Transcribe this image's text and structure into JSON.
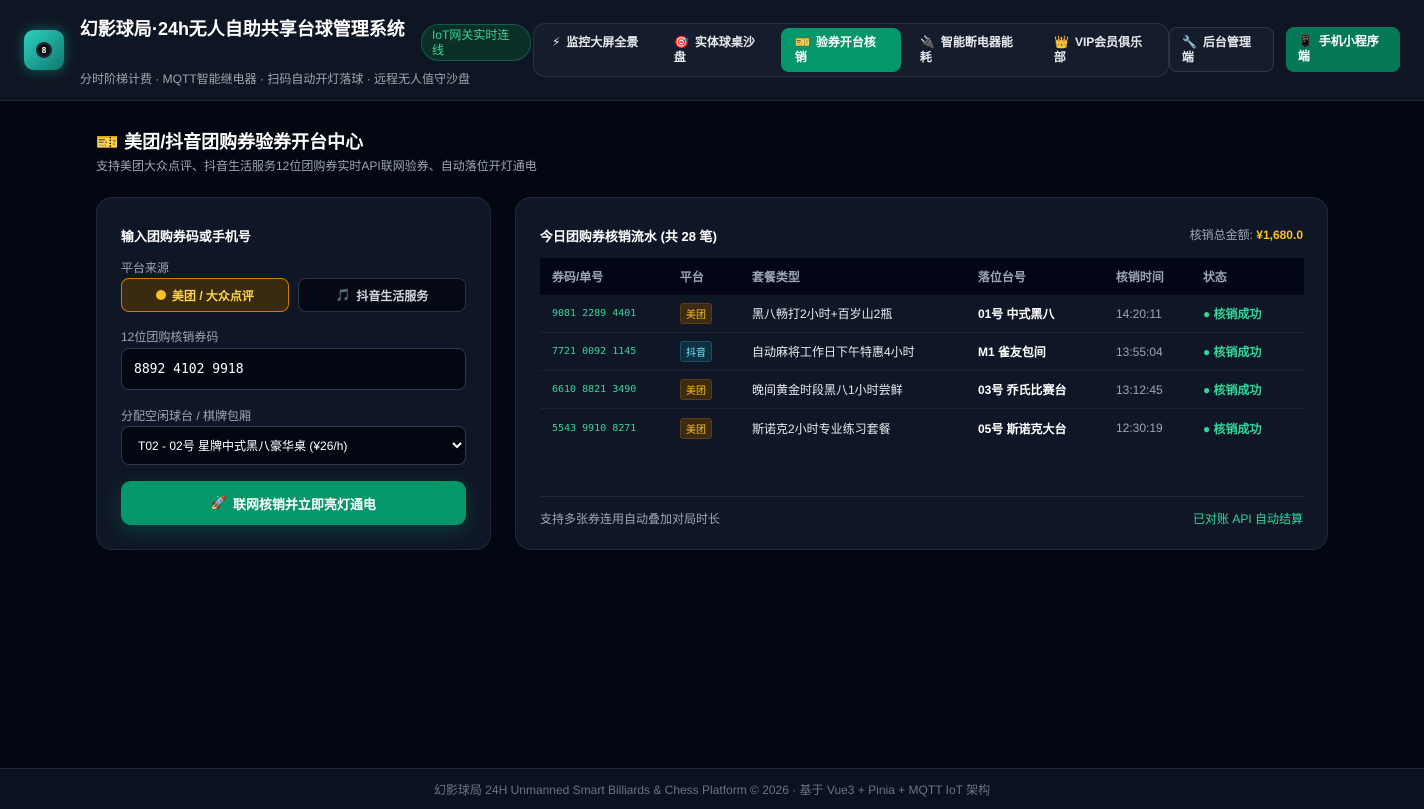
{
  "header": {
    "title": "幻影球局·24h无人自助共享台球管理系统",
    "subtitle": "分时阶梯计费 · MQTT智能继电器 · 扫码自动开灯落球 · 远程无人值守沙盘",
    "iot_badge": "IoT网关实时连线",
    "nav": [
      {
        "icon": "⚡",
        "label": "监控大屏全景"
      },
      {
        "icon": "🎯",
        "label": "实体球桌沙盘"
      },
      {
        "icon": "🎫",
        "label": "验券开台核销"
      },
      {
        "icon": "🔌",
        "label": "智能断电器能耗"
      },
      {
        "icon": "👑",
        "label": "VIP会员俱乐部"
      }
    ],
    "admin_icon": "🔧",
    "admin_label": "后台管理端",
    "mini_icon": "📱",
    "mini_label": "手机小程序端"
  },
  "page": {
    "icon": "🎫",
    "title": "美团/抖音团购券验券开台中心",
    "desc": "支持美团大众点评、抖音生活服务12位团购券实时API联网验券、自动落位开灯通电"
  },
  "form": {
    "heading": "输入团购券码或手机号",
    "platform_label": "平台来源",
    "platform_meituan": "美团 / 大众点评",
    "platform_douyin_icon": "🎵",
    "platform_douyin": "抖音生活服务",
    "code_label": "12位团购核销券码",
    "code_value": "8892 4102 9918",
    "table_label": "分配空闲球台 / 棋牌包厢",
    "table_value": "T02 - 02号 星牌中式黑八豪华桌 (¥26/h)",
    "submit_icon": "🚀",
    "submit_label": "联网核销并立即亮灯通电"
  },
  "records": {
    "heading": "今日团购券核销流水 (共 28 笔)",
    "total_label": "核销总金额:",
    "total_value": "¥1,680.0",
    "columns": [
      "券码/单号",
      "平台",
      "套餐类型",
      "落位台号",
      "核销时间",
      "状态"
    ],
    "rows": [
      {
        "code": "9081 2289 4401",
        "platform": "美团",
        "package": "黑八畅打2小时+百岁山2瓶",
        "table": "01号 中式黑八",
        "time": "14:20:11",
        "status": "● 核销成功"
      },
      {
        "code": "7721 0092 1145",
        "platform": "抖音",
        "package": "自动麻将工作日下午特惠4小时",
        "table": "M1 雀友包间",
        "time": "13:55:04",
        "status": "● 核销成功"
      },
      {
        "code": "6610 8821 3490",
        "platform": "美团",
        "package": "晚间黄金时段黑八1小时尝鲜",
        "table": "03号 乔氏比赛台",
        "time": "13:12:45",
        "status": "● 核销成功"
      },
      {
        "code": "5543 9910 8271",
        "platform": "美团",
        "package": "斯诺克2小时专业练习套餐",
        "table": "05号 斯诺克大台",
        "time": "12:30:19",
        "status": "● 核销成功"
      }
    ],
    "footnote_left": "支持多张券连用自动叠加对局时长",
    "footnote_right": "已对账 API 自动结算"
  },
  "footer": "幻影球局 24H Unmanned Smart Billiards & Chess Platform © 2026 · 基于 Vue3 + Pinia + MQTT IoT 架构"
}
